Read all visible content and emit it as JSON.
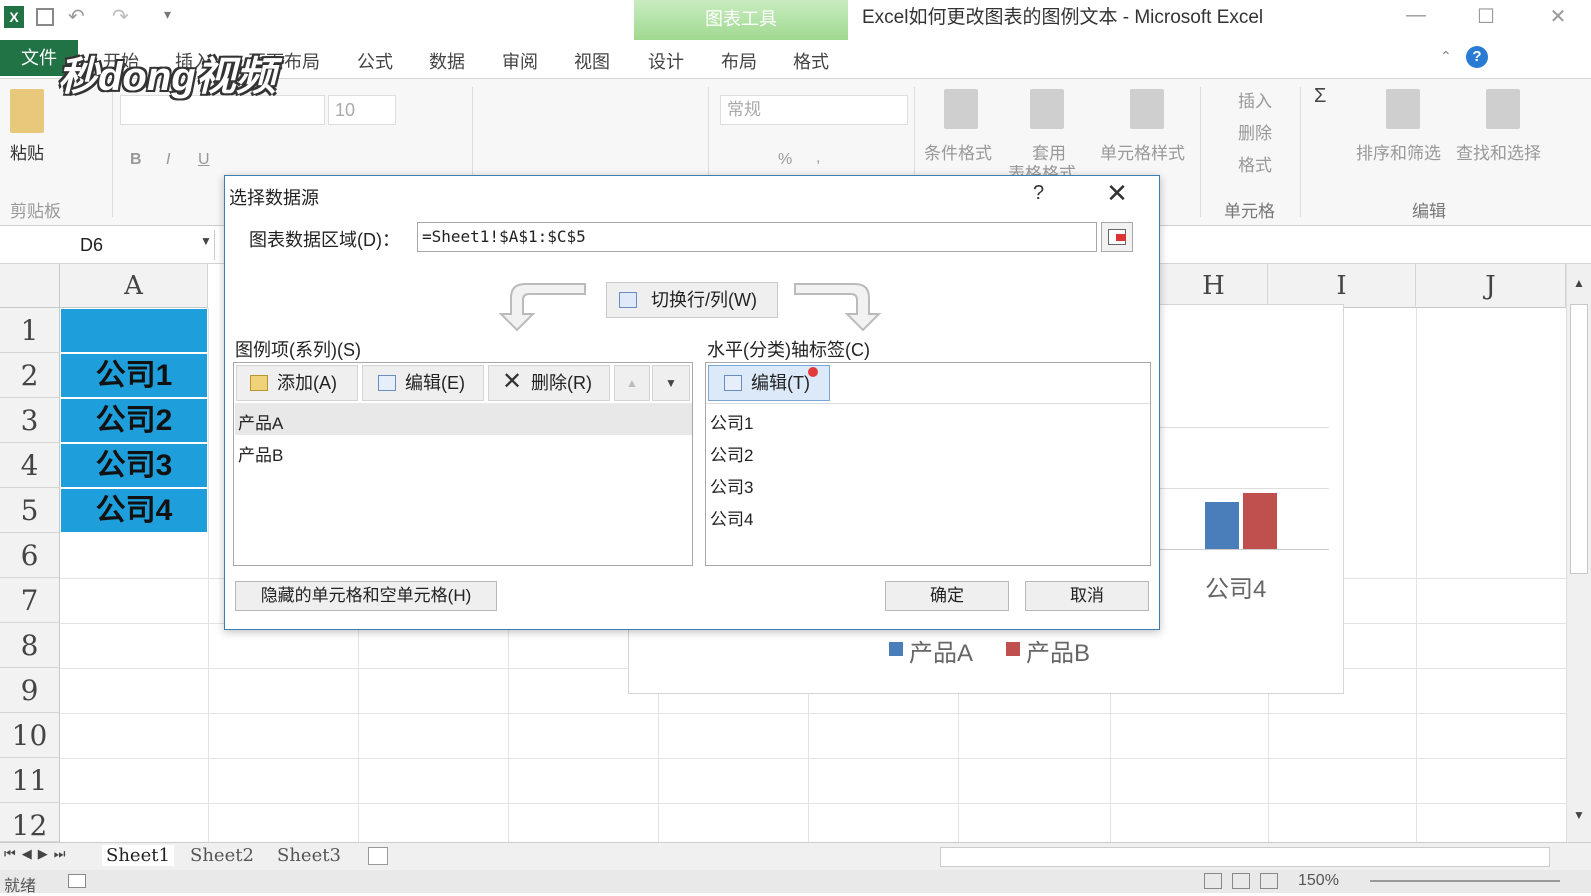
{
  "window": {
    "title": "Excel如何更改图表的图例文本 - Microsoft Excel",
    "context_tab_group": "图表工具"
  },
  "ribbon_tabs": [
    "文件",
    "开始",
    "插入",
    "页面布局",
    "公式",
    "数据",
    "审阅",
    "视图",
    "设计",
    "布局",
    "格式"
  ],
  "ribbon": {
    "paste_label": "粘贴",
    "clipboard_group": "剪贴板",
    "font_size": "10",
    "number_format": "常规",
    "conditional_format": "条件格式",
    "table_format": "套用",
    "table_format_2": "表格格式",
    "cell_style": "单元格样式",
    "insert": "插入",
    "delete": "删除",
    "format": "格式",
    "cells_group": "单元格",
    "sort_filter": "排序和筛选",
    "find_select": "查找和选择",
    "edit_group": "编辑",
    "bold": "B",
    "italic": "I",
    "underline": "U",
    "percent": "%",
    "comma": ","
  },
  "logo_text": "秒dong视频",
  "formula_bar": {
    "name_box": "D6"
  },
  "grid": {
    "columns": [
      "A",
      "H",
      "I",
      "J"
    ],
    "rows": [
      "1",
      "2",
      "3",
      "4",
      "5",
      "6",
      "7",
      "8",
      "9",
      "10",
      "11",
      "12"
    ],
    "cells_a": [
      "",
      "公司1",
      "公司2",
      "公司3",
      "公司4"
    ]
  },
  "chart": {
    "category_label": "公司4",
    "legend": [
      {
        "name": "产品A",
        "color": "#4a7ebb"
      },
      {
        "name": "产品B",
        "color": "#c0504d"
      }
    ]
  },
  "dialog": {
    "title": "选择数据源",
    "help": "?",
    "close": "✕",
    "range_label": "图表数据区域(D)：",
    "range_value": "=Sheet1!$A$1:$C$5",
    "switch_button": "切换行/列(W)",
    "legend_panel_label": "图例项(系列)(S)",
    "add_button": "添加(A)",
    "edit_button": "编辑(E)",
    "delete_button": "删除(R)",
    "series": [
      "产品A",
      "产品B"
    ],
    "axis_panel_label": "水平(分类)轴标签(C)",
    "axis_edit_button": "编辑(T)",
    "categories": [
      "公司1",
      "公司2",
      "公司3",
      "公司4"
    ],
    "hidden_cells_button": "隐藏的单元格和空单元格(H)",
    "ok_button": "确定",
    "cancel_button": "取消"
  },
  "sheets": [
    "Sheet1",
    "Sheet2",
    "Sheet3"
  ],
  "status": {
    "ready": "就绪",
    "zoom": "150%"
  }
}
